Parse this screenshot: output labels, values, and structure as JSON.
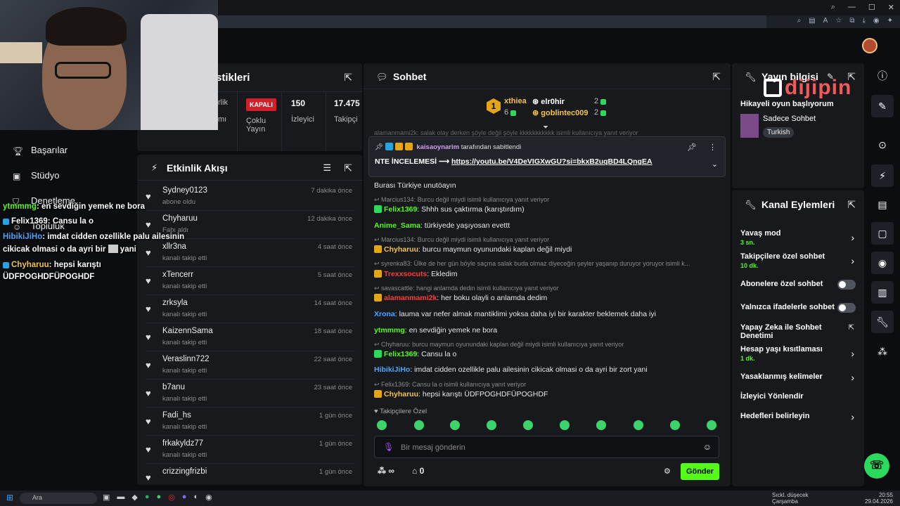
{
  "browser": {
    "icons": [
      "zoom-icon",
      "reader-icon",
      "translate-icon",
      "star-icon",
      "extensions-icon",
      "downloads-icon",
      "profile-icon",
      "ai-icon"
    ]
  },
  "overlay_chat": [
    {
      "user": "ytmmmg",
      "text": ": en sevdiğin yemek ne bora"
    },
    {
      "user": "Felix1369",
      "text": ": Cansu la o"
    },
    {
      "user": "HibikiJiHo",
      "text": ": imdat cidden ozellikle palu ailesinin"
    },
    {
      "user": "",
      "text": "cikicak olmasi o da ayri bir",
      "tail": "yani"
    },
    {
      "user": "Chyharuu",
      "text": ": hepsi karıştı"
    },
    {
      "user": "",
      "text": "ÜDFPOGHDFÜPOGHDF"
    }
  ],
  "leftnav": {
    "items": [
      {
        "label": "Başarılar"
      },
      {
        "label": "Stüdyo"
      },
      {
        "label": "Denetleme"
      },
      {
        "label": "Topluluk"
      }
    ]
  },
  "stats": {
    "title": "stikleri",
    "cols": [
      {
        "line1": "rlik",
        "line2": "Gelir",
        "line3": "Programı"
      },
      {
        "badge": "KAPALI",
        "line1": "Çoklu",
        "line2": "Yayın"
      },
      {
        "big": "150",
        "label": "İzleyici"
      },
      {
        "big": "17.475",
        "label": "Takipçi"
      }
    ]
  },
  "activity": {
    "title": "Etkinlik Akışı",
    "rows": [
      {
        "name": "Sydney0123",
        "sub": "abone oldu",
        "time": "7 dakika önce"
      },
      {
        "name": "Chyharuu",
        "sub": "Fabı aldı",
        "time": "12 dakika önce"
      },
      {
        "name": "xllr3na",
        "sub": "kanalı takip etti",
        "time": "4 saat önce"
      },
      {
        "name": "xTencerr",
        "sub": "kanalı takip etti",
        "time": "5 saat önce"
      },
      {
        "name": "zrksyla",
        "sub": "kanalı takip etti",
        "time": "14 saat önce"
      },
      {
        "name": "KaizennSama",
        "sub": "kanalı takip etti",
        "time": "18 saat önce"
      },
      {
        "name": "Veraslinn722",
        "sub": "kanalı takip etti",
        "time": "22 saat önce"
      },
      {
        "name": "b7anu",
        "sub": "kanalı takip etti",
        "time": "23 saat önce"
      },
      {
        "name": "Fadi_hs",
        "sub": "kanalı takip etti",
        "time": "1 gün önce"
      },
      {
        "name": "frkakyldz77",
        "sub": "kanalı takip etti",
        "time": "1 gün önce"
      },
      {
        "name": "crizzingfrizbi",
        "sub": "",
        "time": "1 gün önce"
      }
    ]
  },
  "chat": {
    "title": "Sohbet",
    "leaderboard": [
      {
        "name": "xthiea",
        "rank": "1",
        "count": "6"
      },
      {
        "name": "elr0hir",
        "count": "2"
      },
      {
        "name": "goblintec009",
        "count": "2"
      }
    ],
    "top_clipped": "alamanmami2k: salak olay derken şöyle değil şöyle kkkkkkkkkkk isimli kullanıcıya yanıt veriyor",
    "pinned": {
      "by_user": "kaisaoynarim",
      "by_suffix": "tarafından sabitlendi",
      "text": "NTE İNCELEMESİ ⟶",
      "link": "https://youtu.be/V4DeVIGXwGU?si=bkxB2uqBD4LQngEA"
    },
    "messages": [
      {
        "type": "text",
        "user": "",
        "text": "Burası Türkiye unutöayın"
      },
      {
        "type": "reply",
        "text": "Marcius134: Burcu değil miydi isimli kullanıcıya yanıt veriyor"
      },
      {
        "type": "msg",
        "user": "Felix1369",
        "color": "green",
        "badge": "green",
        "text": ": Shhh sus çaktırma (karıştırdım)"
      },
      {
        "type": "msg",
        "user": "Anime_Sama",
        "color": "lime",
        "text": ": türkiyede yaşıyosan evettt"
      },
      {
        "type": "reply",
        "text": "Marcius134: Burcu değil miydi isimli kullanıcıya yanıt veriyor"
      },
      {
        "type": "msg",
        "user": "Chyharuu",
        "color": "gold",
        "badge": "gold",
        "text": ": burcu maymun oyunundaki kaplan değil miydi"
      },
      {
        "type": "reply",
        "text": "syrenka83: Ülke de her gün böyle saçma salak buda olmaz diyeceğin şeyler yaşanıp duruyor yoruyor isimli k..."
      },
      {
        "type": "msg",
        "user": "Trexxsocuts",
        "color": "red",
        "badge": "gold",
        "text": ": Ekledim"
      },
      {
        "type": "reply",
        "text": "savascattle: hangi anlamda dedin isimli kullanıcıya yanıt veriyor"
      },
      {
        "type": "msg",
        "user": "alamanmami2k",
        "color": "red",
        "badge": "gold",
        "text": ": her boku olayli o anlamda dedim"
      },
      {
        "type": "msg",
        "user": "Xrona",
        "color": "blue",
        "text": ": lauma var nefer almak mantiklimi yoksa daha iyi bir karakter beklemek daha iyi"
      },
      {
        "type": "msg",
        "user": "ytmmmg",
        "color": "lime",
        "text": ": en sevdiğin yemek ne bora"
      },
      {
        "type": "reply",
        "text": "Chyharuu: burcu maymun oyunundaki kaplan değil miydi isimli kullanıcıya yanıt veriyor"
      },
      {
        "type": "msg",
        "user": "Felix1369",
        "color": "green",
        "badge": "green",
        "text": ": Cansu la o"
      },
      {
        "type": "msg",
        "user": "HibikiJiHo",
        "color": "blue",
        "text": ": imdat cidden ozellikle palu ailesinin cikicak olmasi o da ayri bir zort yani"
      },
      {
        "type": "reply",
        "text": "Felix1369: Cansu la o isimli kullanıcıya yanıt veriyor"
      },
      {
        "type": "msg",
        "user": "Chyharuu",
        "color": "gold",
        "badge": "gold",
        "text": ": hepsi karıştı ÜDFPOGHDFÜPOGHDF"
      }
    ],
    "followers_only": "Takipçilere Özel",
    "input_placeholder": "Bir mesaj gönderin",
    "points": "∞",
    "store_count": "0",
    "send": "Gönder"
  },
  "info": {
    "title": "Yayın bilgisi",
    "stream_title": "Hikayeli oyun başlıyorum",
    "category": "Sadece Sohbet",
    "language": "Turkish"
  },
  "logo": "dijipin",
  "actions": {
    "title": "Kanal Eylemleri",
    "items": [
      {
        "label": "Yavaş mod",
        "value": "3 sn.",
        "control": "chevron"
      },
      {
        "label": "Takipçilere özel sohbet",
        "value": "10 dk.",
        "control": "chevron"
      },
      {
        "label": "Abonelere özel sohbet",
        "value": "",
        "control": "toggle"
      },
      {
        "label": "Yalnızca ifadelerle sohbet",
        "value": "",
        "control": "toggle"
      },
      {
        "label": "Yapay Zeka ile Sohbet Denetimi",
        "value": "",
        "control": "external"
      },
      {
        "label": "Hesap yaşı kısıtlaması",
        "value": "1 dk.",
        "control": "chevron"
      },
      {
        "label": "Yasaklanmış kelimeler",
        "value": "",
        "control": "chevron"
      },
      {
        "label": "İzleyici Yönlendir",
        "value": "",
        "control": "none"
      },
      {
        "label": "Hedefleri belirleyin",
        "value": "",
        "control": "chevron"
      }
    ]
  },
  "taskbar": {
    "search": "Ara",
    "weather": "Sıckl. düşecek",
    "weather2": "Çarşamba",
    "time": "20:55",
    "date": "29.04.2026"
  }
}
